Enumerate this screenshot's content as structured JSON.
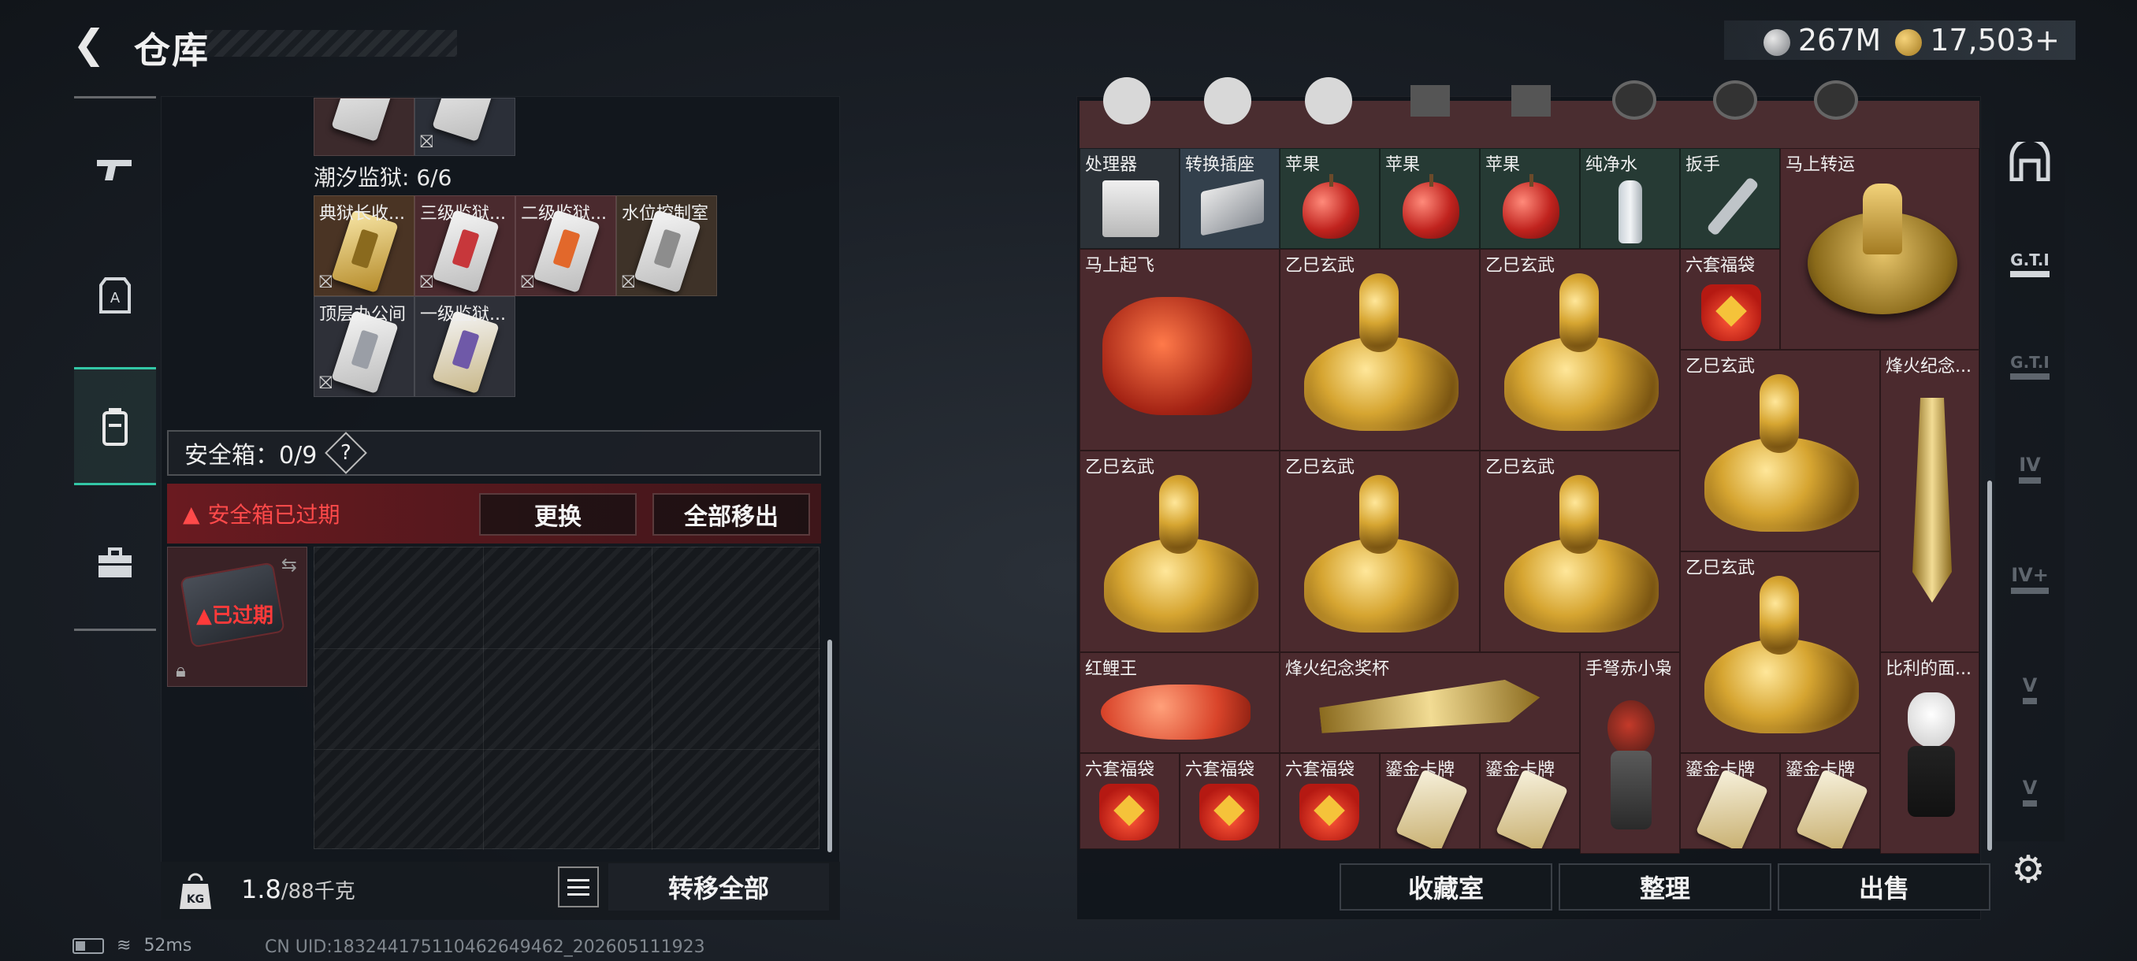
{
  "header": {
    "back_icon": "back-arrow-icon",
    "title": "仓库",
    "currency_silver": "267M",
    "currency_gold": "17,503",
    "add_symbol": "+"
  },
  "left_nav": [
    {
      "icon": "gun-icon"
    },
    {
      "icon": "armor-icon"
    },
    {
      "icon": "backpack-icon",
      "active": true
    },
    {
      "icon": "toolbox-icon"
    }
  ],
  "left_panel": {
    "prison_label": "潮汐监狱: 6/6",
    "key_cards": [
      {
        "label": "典狱长收..."
      },
      {
        "label": "三级监狱..."
      },
      {
        "label": "二级监狱..."
      },
      {
        "label": "水位控制室"
      },
      {
        "label": "顶层办公间"
      },
      {
        "label": "一级监狱..."
      }
    ],
    "safebox_label": "安全箱：0/9",
    "help": "?",
    "expired_notice": "安全箱已过期",
    "replace_button": "更换",
    "move_all_button": "全部移出",
    "slot_expired": "已过期",
    "weight_icon_label": "KG",
    "weight_value": "1.8",
    "weight_max": "/88千克",
    "transfer_all": "转移全部"
  },
  "inventory": {
    "items": [
      {
        "label": "处理器"
      },
      {
        "label": "转换插座"
      },
      {
        "label": "苹果"
      },
      {
        "label": "苹果"
      },
      {
        "label": "苹果"
      },
      {
        "label": "纯净水"
      },
      {
        "label": "扳手"
      },
      {
        "label": "马上转运"
      },
      {
        "label": "马上起飞"
      },
      {
        "label": "乙巳玄武"
      },
      {
        "label": "乙巳玄武"
      },
      {
        "label": "六套福袋"
      },
      {
        "label": "乙巳玄武"
      },
      {
        "label": "烽火纪念..."
      },
      {
        "label": "乙巳玄武"
      },
      {
        "label": "乙巳玄武"
      },
      {
        "label": "乙巳玄武"
      },
      {
        "label": "乙巳玄武"
      },
      {
        "label": "红鲤王"
      },
      {
        "label": "烽火纪念奖杯"
      },
      {
        "label": "手弩赤小枭"
      },
      {
        "label": "比利的面..."
      },
      {
        "label": "六套福袋"
      },
      {
        "label": "六套福袋"
      },
      {
        "label": "六套福袋"
      },
      {
        "label": "鎏金卡牌"
      },
      {
        "label": "鎏金卡牌"
      },
      {
        "label": "鎏金卡牌"
      },
      {
        "label": "鎏金卡牌"
      }
    ]
  },
  "bottom_right": {
    "collection": "收藏室",
    "organize": "整理",
    "sell": "出售"
  },
  "right_nav": [
    {
      "icon": "arch-icon",
      "text": ""
    },
    {
      "icon": "gti-case-icon",
      "text": "G.T.I"
    },
    {
      "icon": "gti-folder-icon",
      "text": "G.T.I"
    },
    {
      "icon": "iv-folder-icon",
      "text": "IV"
    },
    {
      "icon": "iv-add-icon",
      "text": "IV+"
    },
    {
      "icon": "v-search-icon",
      "text": "V"
    },
    {
      "icon": "v-search-icon-2",
      "text": "V"
    }
  ],
  "status_bar": {
    "ping": "52ms",
    "uid": "CN UID:18324417511046264946​2_202605111923"
  }
}
